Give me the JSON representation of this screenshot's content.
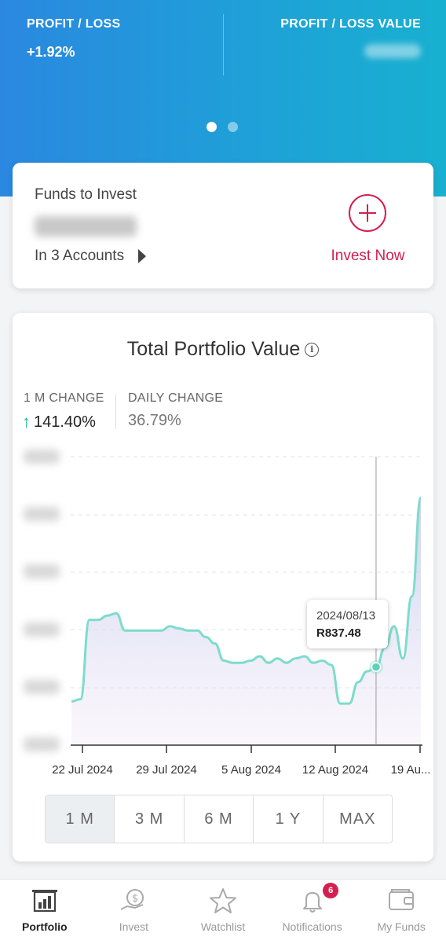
{
  "header": {
    "profit_loss_label": "PROFIT / LOSS",
    "profit_loss_pct": "+1.92%",
    "profit_loss_value_label": "PROFIT / LOSS VALUE"
  },
  "funds": {
    "title": "Funds to Invest",
    "accounts": "In 3 Accounts",
    "invest_now": "Invest Now"
  },
  "portfolio": {
    "title": "Total Portfolio Value",
    "info_glyph": "i",
    "month_change_label": "1 M CHANGE",
    "month_change_value": "141.40%",
    "daily_change_label": "DAILY CHANGE",
    "daily_change_value": "36.79%",
    "tooltip": {
      "date": "2024/08/13",
      "value": "R837.48"
    },
    "ranges": [
      "1 M",
      "3 M",
      "6 M",
      "1 Y",
      "MAX"
    ],
    "selected_range": "1 M"
  },
  "chart_data": {
    "type": "area",
    "x_ticks": [
      "22 Jul 2024",
      "29 Jul 2024",
      "5 Aug 2024",
      "12 Aug 2024",
      "19 Au..."
    ],
    "y_tick_labels_visible": false,
    "highlight": {
      "date": "2024/08/13",
      "value": 837.48
    },
    "line_color": "#7ddccb",
    "series": [
      {
        "values": [
          0.05,
          0.06,
          0.43,
          0.43,
          0.45,
          0.46,
          0.38,
          0.38,
          0.38,
          0.38,
          0.38,
          0.4,
          0.39,
          0.38,
          0.38,
          0.35,
          0.32,
          0.24,
          0.23,
          0.23,
          0.24,
          0.26,
          0.23,
          0.25,
          0.23,
          0.25,
          0.26,
          0.23,
          0.24,
          0.22,
          0.04,
          0.04,
          0.14,
          0.19,
          0.21,
          0.3,
          0.4,
          0.25,
          0.54,
          1.0
        ]
      }
    ]
  },
  "nav": {
    "items": [
      {
        "label": "Portfolio",
        "icon": "portfolio-icon"
      },
      {
        "label": "Invest",
        "icon": "invest-icon"
      },
      {
        "label": "Watchlist",
        "icon": "star-icon"
      },
      {
        "label": "Notifications",
        "icon": "bell-icon",
        "badge": "6"
      },
      {
        "label": "My Funds",
        "icon": "wallet-icon"
      }
    ]
  },
  "colors": {
    "accent": "#d3204f",
    "up": "#1bbf9a",
    "hero_start": "#2a88e0",
    "hero_end": "#18b0d0"
  }
}
